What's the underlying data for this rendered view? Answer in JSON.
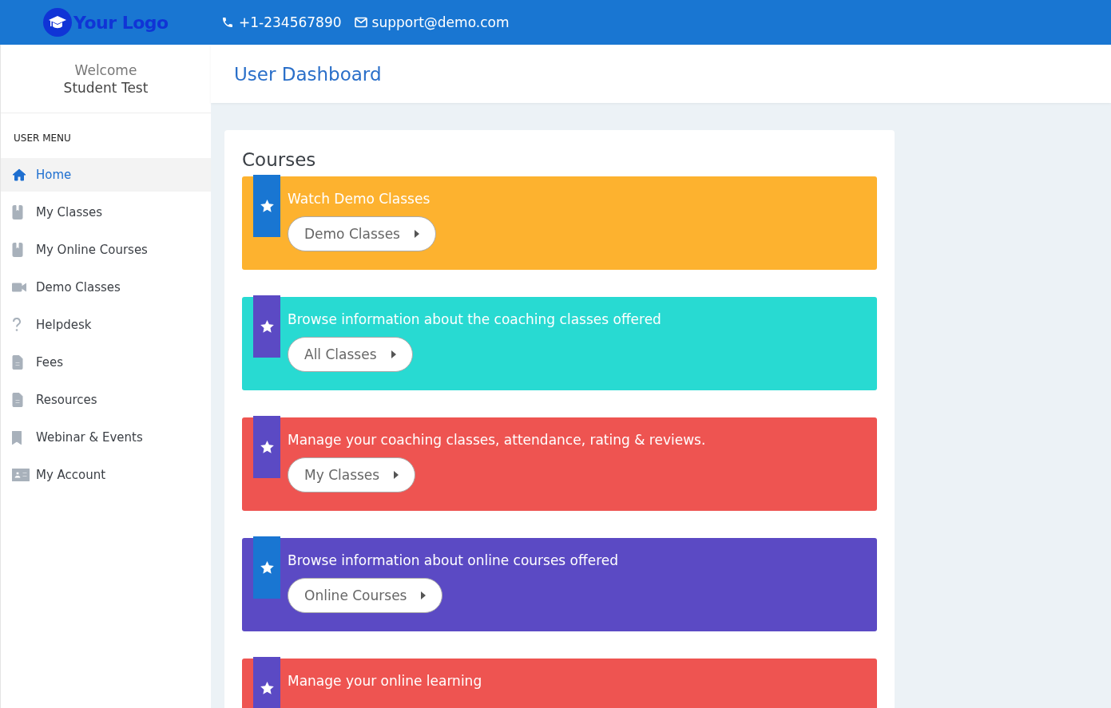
{
  "header": {
    "logo_text": "Your Logo",
    "phone": "+1-234567890",
    "email": "support@demo.com"
  },
  "sidebar": {
    "welcome": "Welcome",
    "user_name": "Student Test",
    "menu_heading": "USER MENU",
    "items": [
      {
        "label": "Home",
        "kind": "home",
        "selected": true
      },
      {
        "label": "My Classes",
        "kind": "book",
        "selected": false
      },
      {
        "label": "My Online Courses",
        "kind": "book",
        "selected": false
      },
      {
        "label": "Demo Classes",
        "kind": "video",
        "selected": false
      },
      {
        "label": "Helpdesk",
        "kind": "question",
        "selected": false
      },
      {
        "label": "Fees",
        "kind": "document",
        "selected": false
      },
      {
        "label": "Resources",
        "kind": "document",
        "selected": false
      },
      {
        "label": "Webinar & Events",
        "kind": "bookmark",
        "selected": false
      },
      {
        "label": "My Account",
        "kind": "idcard",
        "selected": false
      }
    ]
  },
  "page_title": "User Dashboard",
  "courses": {
    "title": "Courses",
    "cards": [
      {
        "text": "Watch Demo Classes",
        "button": "Demo Classes",
        "color": "#fdb22f",
        "ribbon": {
          "color": "#1976d2"
        }
      },
      {
        "text": "Browse information about the coaching classes offered",
        "button": "All Classes",
        "color": "#28dad2",
        "ribbon": {
          "color": "#5b4ac4"
        }
      },
      {
        "text": "Manage your coaching classes, attendance, rating & reviews.",
        "button": "My Classes",
        "color": "#ee5451",
        "ribbon": {
          "color": "#5b4ac4"
        }
      },
      {
        "text": "Browse information about online courses offered",
        "button": "Online Courses",
        "color": "#5b4ac4",
        "ribbon": {
          "color": "#1976d2"
        }
      },
      {
        "text": "Manage your online learning",
        "color": "#ee5451",
        "ribbon": {
          "color": "#5b4ac4"
        }
      }
    ]
  }
}
